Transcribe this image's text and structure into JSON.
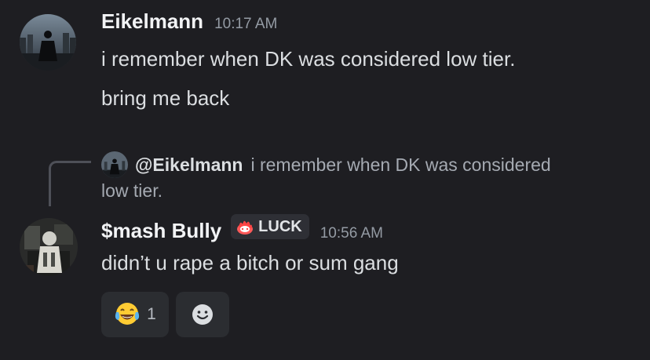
{
  "messages": [
    {
      "username": "Eikelmann",
      "timestamp": "10:17 AM",
      "lines": [
        "i remember when DK was considered low tier.",
        "bring me back"
      ]
    },
    {
      "reply": {
        "mention": "@Eikelmann",
        "preview_line1": "i remember when DK was considered",
        "preview_line2": "low tier."
      },
      "username": "$mash Bully",
      "role_badge": {
        "label": "LUCK",
        "icon": "flame-icon"
      },
      "timestamp": "10:56 AM",
      "lines": [
        "didn’t u rape a bitch or sum gang"
      ],
      "reactions": [
        {
          "emoji": "😂",
          "icon": "laughing-tears-emoji",
          "count": "1"
        }
      ],
      "add_reaction_icon": "smiley-add-reaction-icon"
    }
  ],
  "colors": {
    "background": "#1e1e22",
    "username": "#f2f3f5",
    "text": "#dbdee1",
    "muted": "#949ba4",
    "reaction_bg": "#2b2d31"
  }
}
